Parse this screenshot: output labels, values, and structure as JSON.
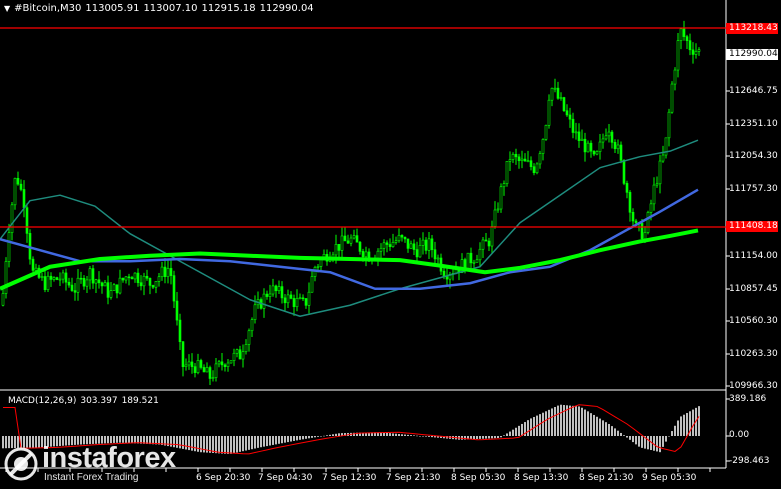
{
  "title_bar": {
    "symbol": "#Bitcoin,M30",
    "open": "113005.91",
    "high": "113007.10",
    "low": "112915.18",
    "close": "112990.04"
  },
  "price_scale": [
    "112646.75",
    "112351.10",
    "112054.30",
    "111757.30",
    "111154.00",
    "110857.45",
    "110560.30",
    "110263.30",
    "109966.30"
  ],
  "levels": {
    "resistance": "113218.43",
    "support": "111408.18",
    "current": "112990.04"
  },
  "macd": {
    "label": "MACD(12,26,9)",
    "main": "303.397",
    "signal": "189.521",
    "scale": [
      "389.186",
      "0.00",
      "-298.463"
    ]
  },
  "time_axis": [
    "6 Sep 20:30",
    "7 Sep 04:30",
    "7 Sep 12:30",
    "7 Sep 21:30",
    "8 Sep 05:30",
    "8 Sep 13:30",
    "8 Sep 21:30",
    "9 Sep 05:30"
  ],
  "watermark": {
    "name": "instaforex",
    "sub": "Instant Forex Trading"
  },
  "colors": {
    "background": "#000000",
    "candle": "#00ff00",
    "level_line": "#ff0000",
    "ma_fast": "#1e8c7e",
    "ma_mid": "#4169e1",
    "ma_slow": "#00ff00",
    "macd_hist": "#c0c0c0",
    "macd_signal": "#ff0000"
  }
}
